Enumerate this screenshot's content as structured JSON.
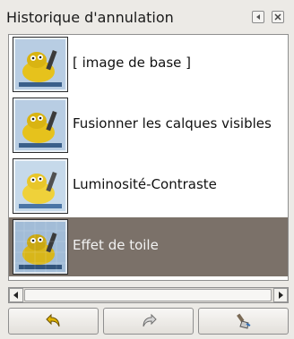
{
  "panel": {
    "title": "Historique d'annulation",
    "header_buttons": [
      "tab-menu-icon",
      "close-icon"
    ]
  },
  "history": {
    "selected_index": 3,
    "items": [
      {
        "label": "[ image de base ]",
        "thumb_icon": "gimp-wilber-thumbnail"
      },
      {
        "label": "Fusionner les calques visibles",
        "thumb_icon": "gimp-wilber-thumbnail"
      },
      {
        "label": "Luminosité-Contraste",
        "thumb_icon": "gimp-wilber-thumbnail"
      },
      {
        "label": "Effet de toile",
        "thumb_icon": "gimp-wilber-thumbnail"
      }
    ]
  },
  "scrollbar": {
    "left_icon": "arrow-left-icon",
    "right_icon": "arrow-right-icon"
  },
  "actions": [
    {
      "icon": "undo-icon"
    },
    {
      "icon": "redo-icon"
    },
    {
      "icon": "clear-history-brush-icon"
    }
  ],
  "colors": {
    "selection": "#7b7169",
    "panel_bg": "#eceae6",
    "wilber_yellow": "#e6c21c",
    "thumb_blue": "#7aa0c8"
  }
}
